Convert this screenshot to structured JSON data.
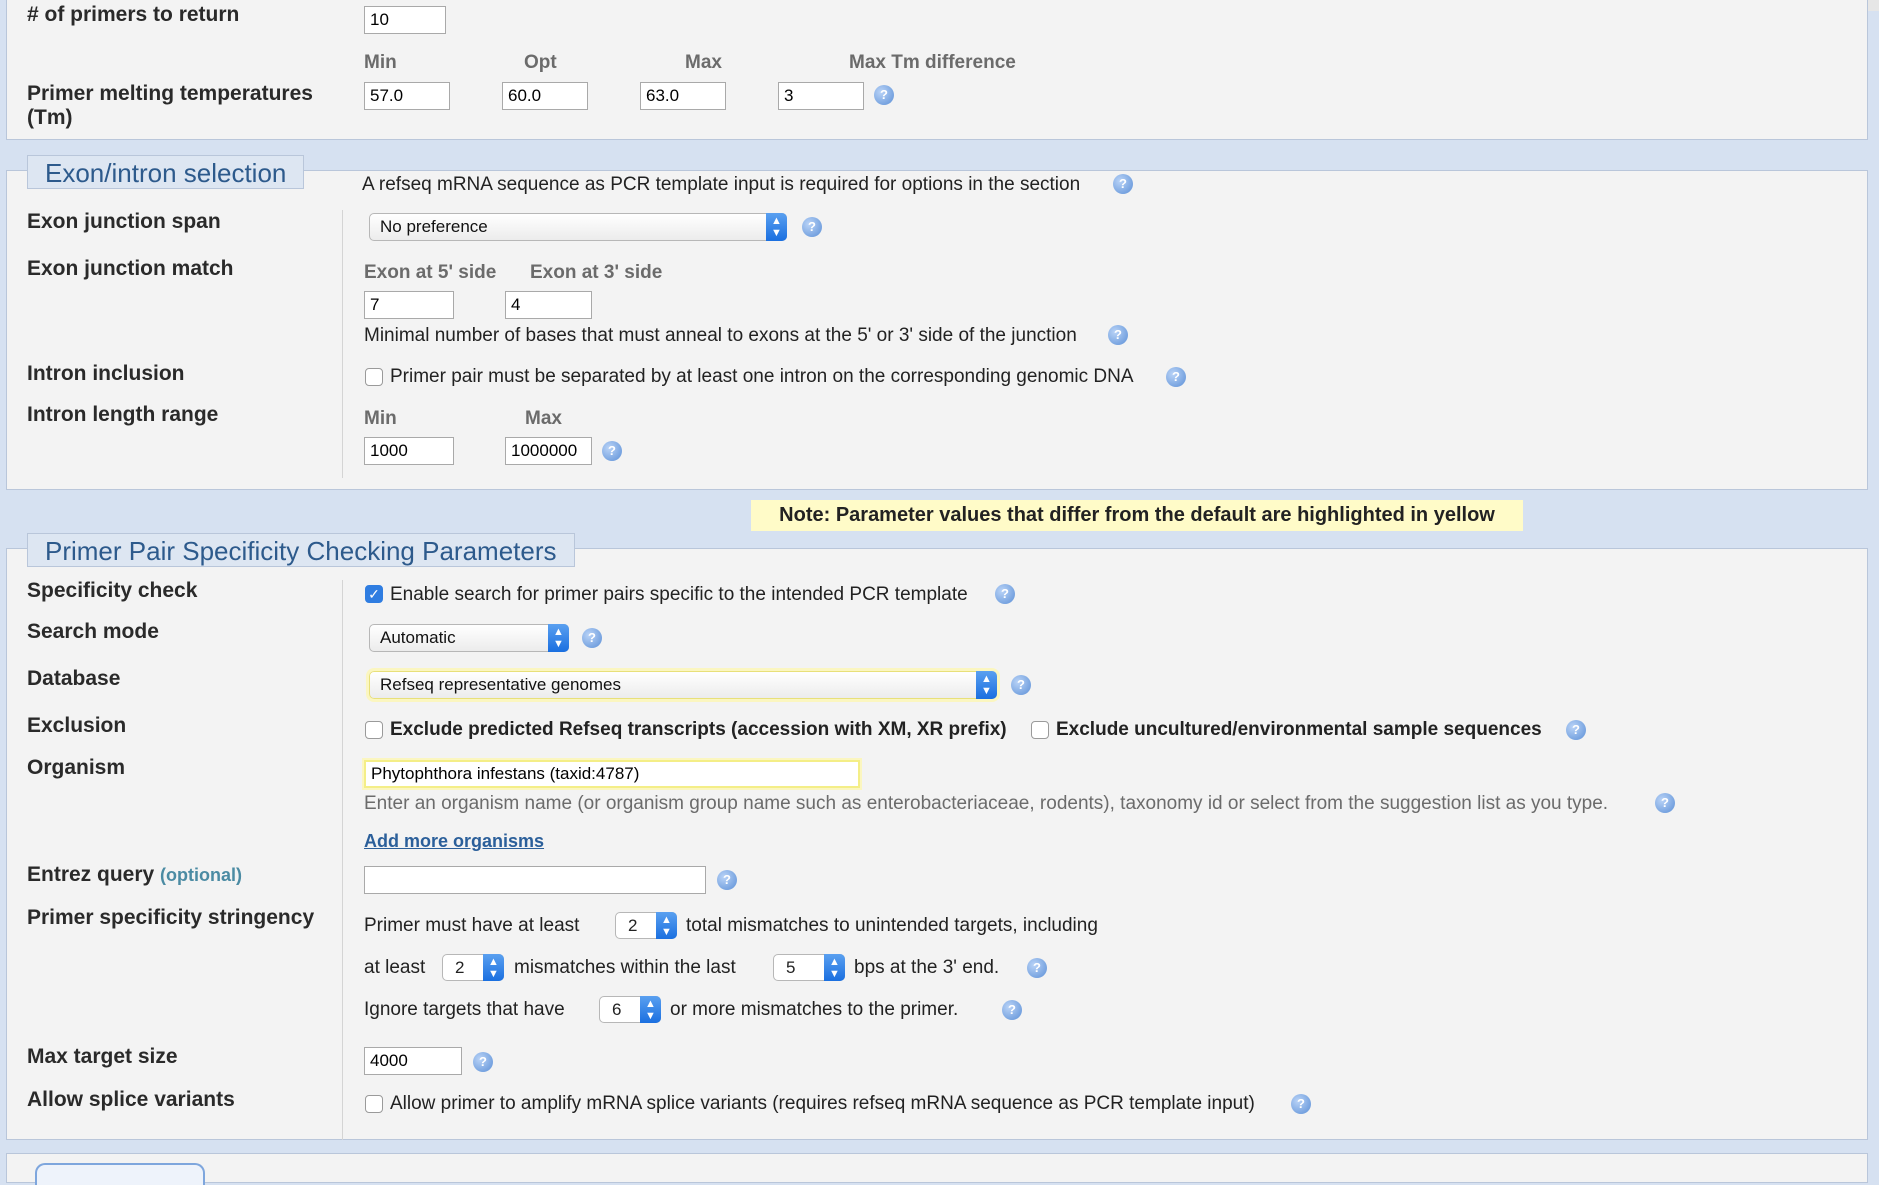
{
  "top": {
    "num_primers_label": "# of primers to return",
    "num_primers_value": "10"
  },
  "tm": {
    "label": "Primer melting temperatures (Tm)",
    "min_label": "Min",
    "opt_label": "Opt",
    "max_label": "Max",
    "diff_label": "Max Tm difference",
    "min_value": "57.0",
    "opt_value": "60.0",
    "max_value": "63.0",
    "diff_value": "3"
  },
  "exon": {
    "legend": "Exon/intron selection",
    "note": "A refseq mRNA sequence as PCR template input is required for options in the section",
    "junction_span_label": "Exon junction span",
    "junction_span_value": "No preference",
    "junction_match_label": "Exon junction match",
    "five_side_label": "Exon at 5' side",
    "three_side_label": "Exon at 3' side",
    "five_side_value": "7",
    "three_side_value": "4",
    "junction_note": "Minimal number of bases that must anneal to exons at the 5' or 3' side of the junction",
    "intron_inclusion_label": "Intron inclusion",
    "intron_inclusion_text": "Primer pair must be separated by at least one intron on the corresponding genomic DNA",
    "intron_range_label": "Intron length range",
    "intron_min_label": "Min",
    "intron_max_label": "Max",
    "intron_min_value": "1000",
    "intron_max_value": "1000000"
  },
  "note_banner": "Note: Parameter values that differ from the default are highlighted in yellow",
  "spec": {
    "legend": "Primer Pair Specificity Checking Parameters",
    "check_label": "Specificity check",
    "check_text": "Enable search for primer pairs specific to the intended PCR template",
    "search_mode_label": "Search mode",
    "search_mode_value": "Automatic",
    "database_label": "Database",
    "database_value": "Refseq representative genomes",
    "exclusion_label": "Exclusion",
    "exclusion_xm": "Exclude predicted Refseq transcripts (accession with XM, XR prefix)",
    "exclusion_env": "Exclude uncultured/environmental sample sequences",
    "organism_label": "Organism",
    "organism_value": "Phytophthora infestans (taxid:4787)",
    "organism_hint": "Enter an organism name (or organism group name such as enterobacteriaceae, rodents), taxonomy id or select from the suggestion list as you type.",
    "add_organisms": "Add more organisms",
    "entrez_label": "Entrez query",
    "entrez_optional": "(optional)",
    "entrez_value": "",
    "stringency_label": "Primer specificity stringency",
    "str_line1_a": "Primer must have at least",
    "str_total_mm": "2",
    "str_line1_b": "total mismatches to unintended targets, including",
    "str_line2_a": "at least",
    "str_within_mm": "2",
    "str_line2_b": "mismatches within the last",
    "str_last_bps": "5",
    "str_line2_c": "bps at the 3' end.",
    "str_line3_a": "Ignore targets that have",
    "str_ignore_mm": "6",
    "str_line3_b": "or more mismatches to the primer.",
    "max_target_label": "Max target size",
    "max_target_value": "4000",
    "splice_label": "Allow splice variants",
    "splice_text": "Allow primer to amplify mRNA splice variants (requires refseq mRNA sequence as PCR template input)"
  }
}
